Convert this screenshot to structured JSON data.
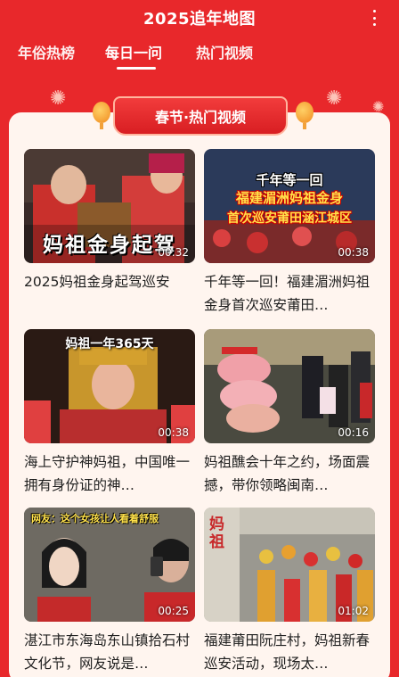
{
  "header": {
    "title": "2025追年地图",
    "more_icon": "more-vertical-icon"
  },
  "tabs": [
    {
      "label": "年俗热榜",
      "active": false
    },
    {
      "label": "每日一问",
      "active": true
    },
    {
      "label": "热门视频",
      "active": false
    }
  ],
  "section": {
    "title": "春节·热门视频"
  },
  "colors": {
    "background": "#e8282b",
    "panel": "#fff5ef",
    "text": "#1e1e1e"
  },
  "videos": [
    {
      "overlay": "妈祖金身起驾",
      "duration": "00:32",
      "caption": "2025妈祖金身起驾巡安"
    },
    {
      "overlay_lines": [
        "千年等一回",
        "福建湄洲妈祖金身",
        "首次巡安莆田涵江城区"
      ],
      "duration": "00:38",
      "caption": "千年等一回！福建湄洲妈祖金身首次巡安莆田…"
    },
    {
      "overlay": "妈祖一年365天",
      "duration": "00:38",
      "caption": "海上守护神妈祖，中国唯一拥有身份证的神…"
    },
    {
      "duration": "00:16",
      "caption": "妈祖醮会十年之约，场面震撼，带你领略闽南…"
    },
    {
      "overlay": "网友：这个女孩让人看着舒服",
      "duration": "00:25",
      "caption": "湛江市东海岛东山镇拾石村文化节，网友说是…"
    },
    {
      "overlay_lines": [
        "妈",
        "祖"
      ],
      "duration": "01:02",
      "caption": "福建莆田阮庄村，妈祖新春巡安活动，现场太…"
    }
  ]
}
